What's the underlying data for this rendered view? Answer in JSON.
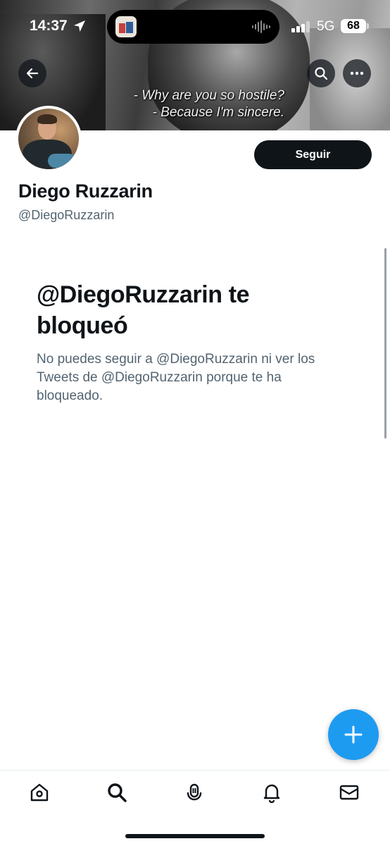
{
  "status_bar": {
    "time": "14:37",
    "network": "5G",
    "battery": "68"
  },
  "banner": {
    "subtitle_line1": "- Why are you so hostile?",
    "subtitle_line2": "- Because I'm sincere."
  },
  "profile": {
    "name": "Diego Ruzzarin",
    "handle": "@DiegoRuzzarin",
    "follow_label": "Seguir"
  },
  "blocked": {
    "title": "@DiegoRuzzarin te bloqueó",
    "message": "No puedes seguir a @DiegoRuzzarin ni ver los Tweets de @DiegoRuzzarin porque te ha bloqueado."
  },
  "nav": {
    "tabs": [
      {
        "icon": "home-icon"
      },
      {
        "icon": "search-icon"
      },
      {
        "icon": "spaces-icon"
      },
      {
        "icon": "bell-icon"
      },
      {
        "icon": "mail-icon"
      }
    ]
  },
  "colors": {
    "accent": "#1d9bf0",
    "text_primary": "#0f1419",
    "text_secondary": "#536471"
  }
}
